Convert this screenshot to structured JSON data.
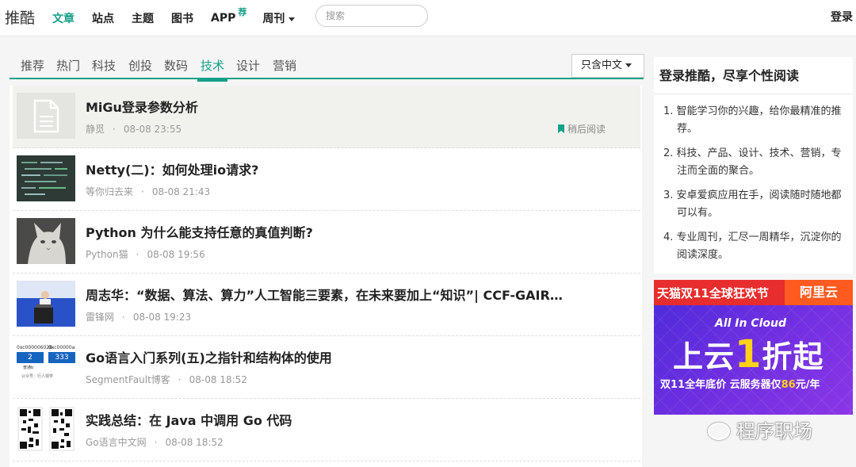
{
  "header": {
    "logo": "推酷",
    "nav": [
      {
        "label": "文章",
        "active": true
      },
      {
        "label": "站点"
      },
      {
        "label": "主题"
      },
      {
        "label": "图书"
      },
      {
        "label": "APP",
        "sup": "荐"
      },
      {
        "label": "周刊",
        "dropdown": true
      }
    ],
    "search_placeholder": "搜索",
    "login": "登录"
  },
  "tabs": [
    "推荐",
    "热门",
    "科技",
    "创投",
    "数码",
    "技术",
    "设计",
    "营销"
  ],
  "active_tab": "技术",
  "lang_filter": "只含中文",
  "articles": [
    {
      "title": "MiGu登录参数分析",
      "source": "静觅",
      "date": "08-08 23:55",
      "later": "稍后阅读",
      "thumb": "doc-icon"
    },
    {
      "title": "Netty(二)：如何处理io请求?",
      "source": "等你归去来",
      "date": "08-08 21:43",
      "thumb": "code-dark"
    },
    {
      "title": "Python 为什么能支持任意的真值判断?",
      "source": "Python猫",
      "date": "08-08 19:56",
      "thumb": "cat"
    },
    {
      "title": "周志华：“数据、算法、算力”人工智能三要素，在未来要加上“知识”| CCF-GAIR…",
      "source": "雷锋网",
      "date": "08-08 19:23",
      "thumb": "speaker"
    },
    {
      "title": "Go语言入门系列(五)之指针和结构体的使用",
      "source": "SegmentFault博客",
      "date": "08-08 18:52",
      "thumb": "pointer",
      "thumb_text": {
        "addr1": "0xc000006028",
        "addr2": "0xc00000a0e0",
        "v1": "2",
        "v2": "333",
        "label": "普通b",
        "qr": "公众号：行人观学"
      }
    },
    {
      "title": "实践总结：在 Java 中调用 Go 代码",
      "source": "Go语言中文网",
      "date": "08-08 18:52",
      "thumb": "qr"
    }
  ],
  "sidebar": {
    "title": "登录推酷，尽享个性阅读",
    "items": [
      "1. 智能学习你的兴趣，给你最精准的推荐。",
      "2. 科技、产品、设计、技术、营销，专注而全面的聚合。",
      "3. 安卓爱疯应用在手，阅读随时随地都可以有。",
      "4. 专业周刊，汇尽一周精华，沉淀你的阅读深度。"
    ]
  },
  "ad": {
    "top_left": "天猫双11全球狂欢节",
    "top_right": "阿里云",
    "tagline": "All In Cloud",
    "main_a": "上云",
    "main_one": "1",
    "main_b": "折起",
    "sub_a": "双11全年底价  云服务器仅",
    "sub_price": "86",
    "sub_b": "元/年"
  },
  "watermark": "程序职场",
  "colors": {
    "accent": "#17a088",
    "ad_red": "#e72d2d",
    "ad_purple": "#5a2ddc"
  }
}
